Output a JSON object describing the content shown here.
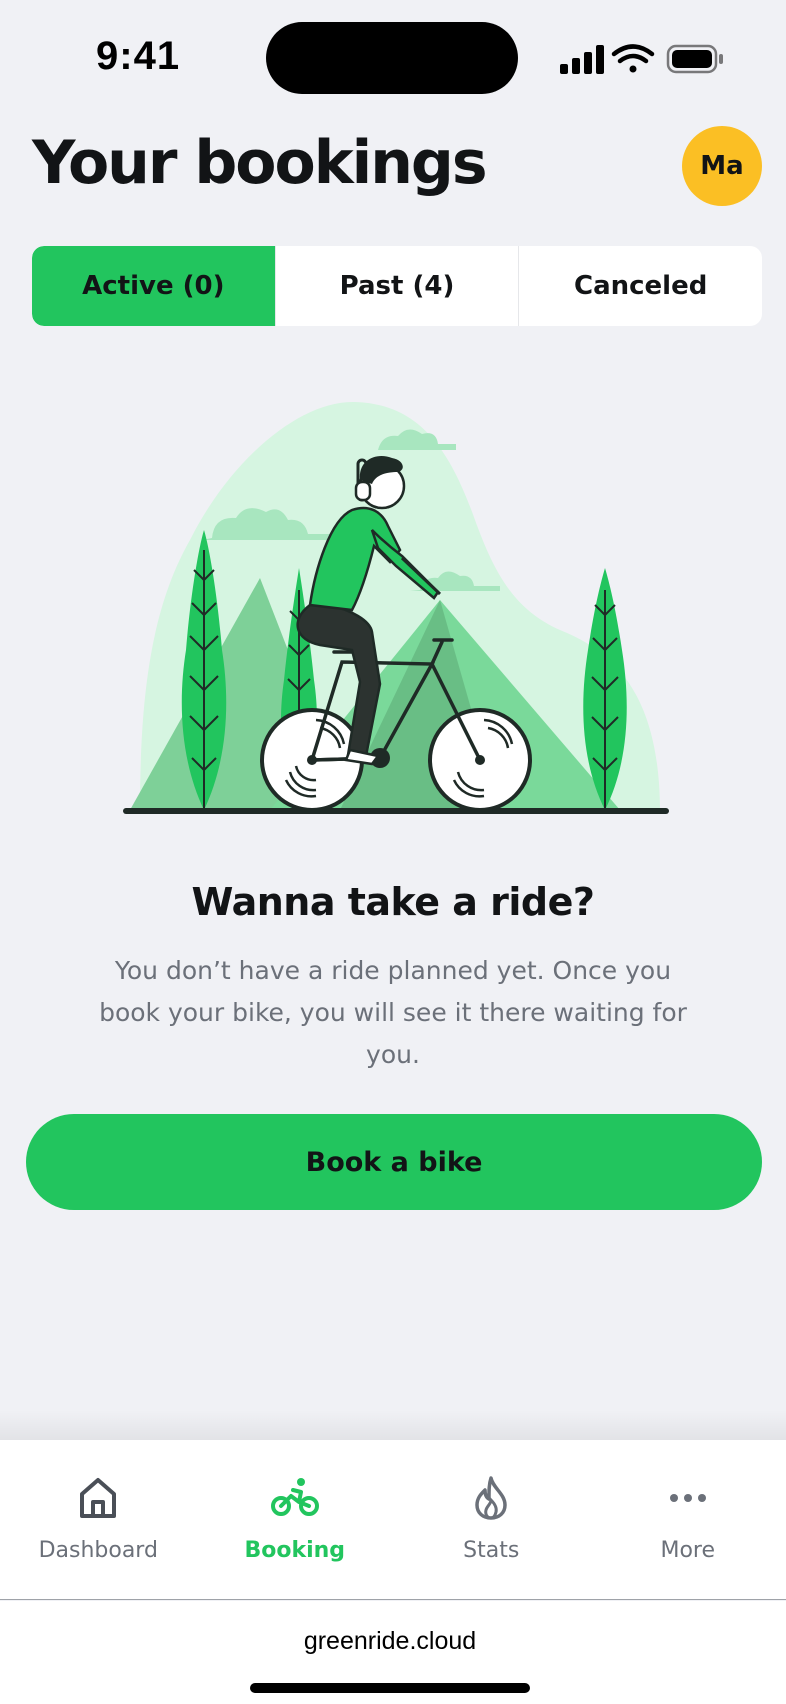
{
  "status_bar": {
    "time": "9:41"
  },
  "header": {
    "title": "Your bookings",
    "avatar_initials": "Ma"
  },
  "tabs": [
    {
      "label": "Active (0)",
      "active": true
    },
    {
      "label": "Past (4)",
      "active": false
    },
    {
      "label": "Canceled",
      "active": false
    }
  ],
  "empty_state": {
    "heading": "Wanna take a ride?",
    "body": "You don’t have a ride planned yet. Once you book your bike, you will see it there waiting for you."
  },
  "cta": {
    "label": "Book a bike"
  },
  "bottom_nav": [
    {
      "label": "Dashboard",
      "icon": "home-icon",
      "active": false
    },
    {
      "label": "Booking",
      "icon": "bike-icon",
      "active": true
    },
    {
      "label": "Stats",
      "icon": "flame-icon",
      "active": false
    },
    {
      "label": "More",
      "icon": "more-icon",
      "active": false
    }
  ],
  "browser": {
    "url": "greenride.cloud"
  },
  "colors": {
    "accent": "#22c55e",
    "avatar": "#fbbf24",
    "background": "#f0f1f5",
    "muted_text": "#6b7079"
  }
}
